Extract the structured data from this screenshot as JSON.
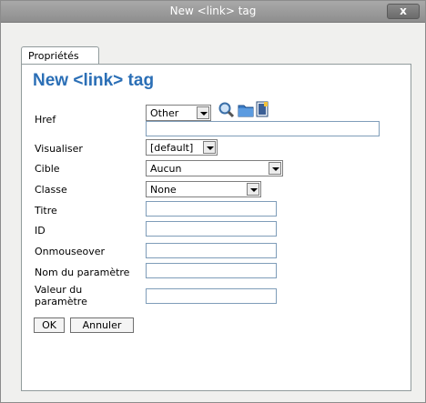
{
  "window": {
    "title": "New <link> tag",
    "close_label": "x"
  },
  "tabs": [
    {
      "label": "Propriétés"
    }
  ],
  "heading": "New <link> tag",
  "fields": {
    "href": {
      "label": "Href",
      "select_value": "Other",
      "value": ""
    },
    "visualiser": {
      "label": "Visualiser",
      "select_value": "[default]"
    },
    "cible": {
      "label": "Cible",
      "select_value": "Aucun"
    },
    "classe": {
      "label": "Classe",
      "select_value": "None"
    },
    "titre": {
      "label": "Titre",
      "value": ""
    },
    "id": {
      "label": "ID",
      "value": ""
    },
    "onmouseover": {
      "label": "Onmouseover",
      "value": ""
    },
    "nom_parametre": {
      "label": "Nom du paramètre",
      "value": ""
    },
    "valeur_parametre": {
      "label_line1": "Valeur du",
      "label_line2": "paramètre",
      "value": ""
    }
  },
  "buttons": {
    "ok": "OK",
    "cancel": "Annuler"
  },
  "icons": [
    "search-icon",
    "folder-icon",
    "document-icon"
  ],
  "colors": {
    "heading": "#2b6fb6",
    "titlebar": "#9a9a9a",
    "input_border": "#7f9db9"
  }
}
